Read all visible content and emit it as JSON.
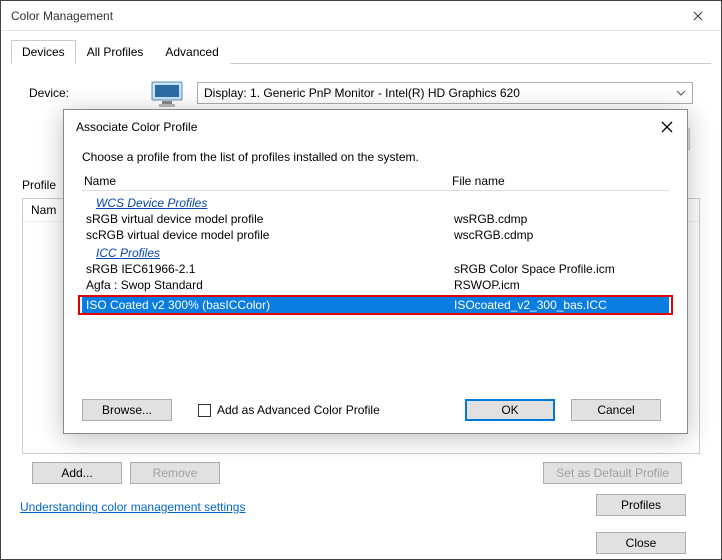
{
  "parent": {
    "title": "Color Management",
    "tabs": [
      "Devices",
      "All Profiles",
      "Advanced"
    ],
    "device_label": "Device:",
    "device_select": "Display: 1. Generic PnP Monitor - Intel(R) HD Graphics 620",
    "profiles_section_label": "Profile",
    "list_header": "Nam",
    "add": "Add...",
    "remove": "Remove",
    "set_default": "Set as Default Profile",
    "link": "Understanding color management settings",
    "profiles_btn": "Profiles",
    "close": "Close"
  },
  "dialog": {
    "title": "Associate Color Profile",
    "instruction": "Choose a profile from the list of profiles installed on the system.",
    "col_name": "Name",
    "col_file": "File name",
    "group_wcs": "WCS Device Profiles",
    "group_icc": "ICC Profiles",
    "rows": {
      "r0": {
        "name": "sRGB virtual device model profile",
        "file": "wsRGB.cdmp"
      },
      "r1": {
        "name": "scRGB virtual device model profile",
        "file": "wscRGB.cdmp"
      },
      "r2": {
        "name": "sRGB IEC61966-2.1",
        "file": "sRGB Color Space Profile.icm"
      },
      "r3": {
        "name": "Agfa : Swop Standard",
        "file": "RSWOP.icm"
      },
      "r4": {
        "name": "ISO Coated v2 300% (basICColor)",
        "file": "ISOcoated_v2_300_bas.ICC"
      }
    },
    "browse": "Browse...",
    "add_adv": "Add as Advanced Color Profile",
    "ok": "OK",
    "cancel": "Cancel"
  }
}
